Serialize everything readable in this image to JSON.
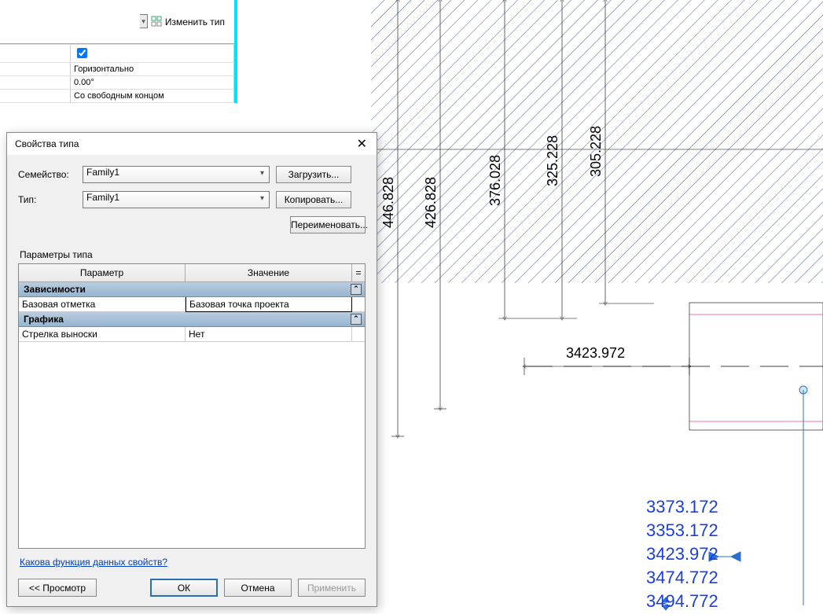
{
  "topStrip": {
    "changeTypeLabel": "Изменить тип",
    "rows": {
      "row1_checked": true,
      "row2": "Горизонтально",
      "row3": "0.00°",
      "row4": "Со свободным концом"
    }
  },
  "dialog": {
    "title": "Свойства типа",
    "family": {
      "label": "Семейство:",
      "value": "Family1"
    },
    "type": {
      "label": "Тип:",
      "value": "Family1"
    },
    "buttons": {
      "load": "Загрузить...",
      "copy": "Копировать...",
      "rename": "Переименовать..."
    },
    "paramsLabel": "Параметры типа",
    "tableHead": {
      "col1": "Параметр",
      "col2": "Значение",
      "col3": "="
    },
    "groups": [
      {
        "name": "Зависимости",
        "rows": [
          {
            "param": "Базовая отметка",
            "value": "Базовая точка проекта",
            "boxed": true
          }
        ]
      },
      {
        "name": "Графика",
        "rows": [
          {
            "param": "Стрелка выноски",
            "value": "Нет"
          }
        ]
      }
    ],
    "helpLink": "Какова функция данных свойств?",
    "footer": {
      "preview": "<< Просмотр",
      "ok": "ОК",
      "cancel": "Отмена",
      "apply": "Применить"
    }
  },
  "canvas": {
    "dims": [
      "446.828",
      "426.828",
      "376.028",
      "325.228",
      "305.228"
    ],
    "hDim": "3423.972",
    "coords": [
      "3373.172",
      "3353.172",
      "3423.972",
      "3474.772",
      "3494.772"
    ]
  }
}
